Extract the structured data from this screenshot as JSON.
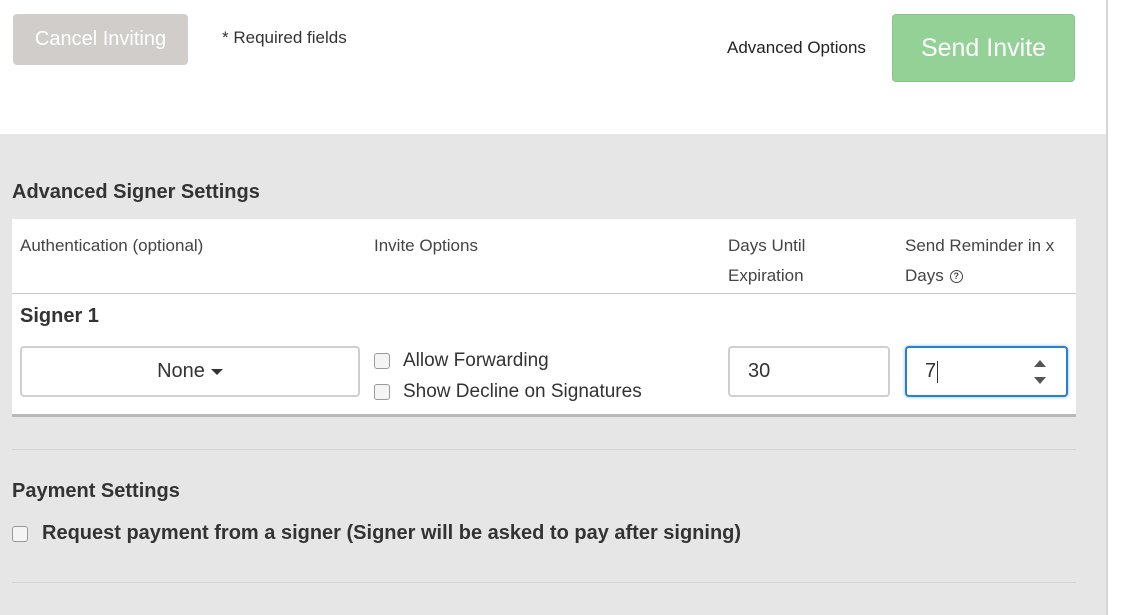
{
  "topbar": {
    "cancel_label": "Cancel Inviting",
    "required_text": "* Required fields",
    "advanced_link": "Advanced Options",
    "send_label": "Send Invite"
  },
  "advanced_signer": {
    "title": "Advanced Signer Settings",
    "columns": {
      "auth": "Authentication (optional)",
      "invite": "Invite Options",
      "expiration_line1": "Days Until",
      "expiration_line2": "Expiration",
      "reminder_line1": "Send Reminder in x",
      "reminder_line2": "Days"
    },
    "help_glyph": "?",
    "signer": {
      "label": "Signer 1",
      "auth_value": "None",
      "allow_forwarding": "Allow Forwarding",
      "show_decline": "Show Decline on Signatures",
      "expiration_days": "30",
      "reminder_days": "7"
    }
  },
  "payment": {
    "title": "Payment Settings",
    "request_label": "Request payment from a signer (Signer will be asked to pay after signing)"
  },
  "colors": {
    "send_button": "#93d196",
    "cancel_button": "#d0cdca",
    "focus_border": "#2a7fd0",
    "panel_background": "#e6e6e6"
  }
}
